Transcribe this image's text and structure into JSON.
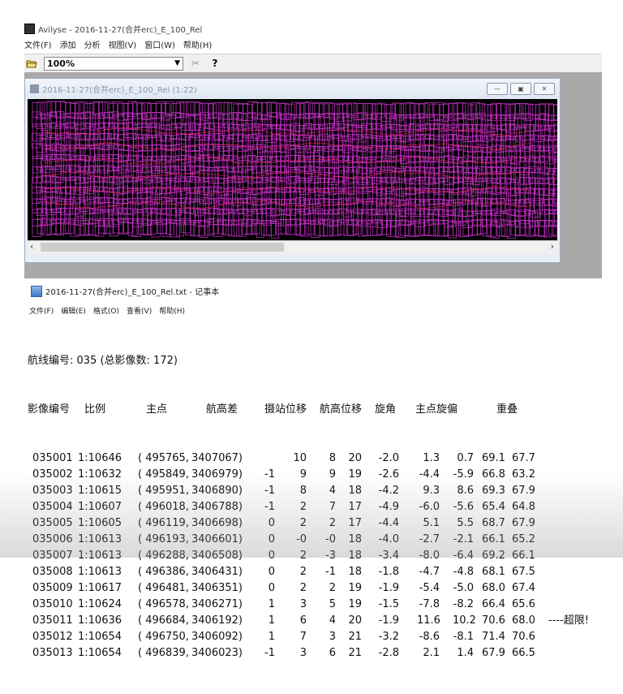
{
  "app": {
    "title": "Avilyse - 2016-11-27(合并erc)_E_100_Rel"
  },
  "menubar": [
    "文件(F)",
    "添加",
    "分析",
    "视图(V)",
    "窗口(W)",
    "帮助(H)"
  ],
  "toolbar": {
    "zoom_value": "100%",
    "cut_icon": "scissors-icon",
    "help_icon": "help-pointer-icon"
  },
  "child_window": {
    "title": "2016-11-27(合并erc)_E_100_Rel (1:22)",
    "buttons": [
      "minimize",
      "restore",
      "close"
    ],
    "canvas_colors": {
      "background": "#000000",
      "footprints": "#cc33cc",
      "highlight": "#ff2255"
    }
  },
  "notepad": {
    "title": "2016-11-27(合并erc)_E_100_Rel.txt - 记事本",
    "menu": [
      "文件(F)",
      "编辑(E)",
      "格式(O)",
      "查看(V)",
      "帮助(H)"
    ],
    "line_info": "航线编号: 035 (总影像数: 172)",
    "headers": [
      "影像编号",
      "比例",
      "主点",
      "航高差",
      "摄站位移",
      "航高位移",
      "旋角",
      "主点旋偏",
      "重叠"
    ],
    "rows": [
      [
        "035001",
        "1:10646",
        "(  495765,",
        "3407067)",
        "",
        "10",
        "8",
        "20",
        "-2.0",
        "1.3",
        "0.7",
        "69.1",
        "67.7",
        ""
      ],
      [
        "035002",
        "1:10632",
        "(  495849,",
        "3406979)",
        "-1",
        "9",
        "9",
        "19",
        "-2.6",
        "-4.4",
        "-5.9",
        "66.8",
        "63.2",
        ""
      ],
      [
        "035003",
        "1:10615",
        "(  495951,",
        "3406890)",
        "-1",
        "8",
        "4",
        "18",
        "-4.2",
        "9.3",
        "8.6",
        "69.3",
        "67.9",
        ""
      ],
      [
        "035004",
        "1:10607",
        "(  496018,",
        "3406788)",
        "-1",
        "2",
        "7",
        "17",
        "-4.9",
        "-6.0",
        "-5.6",
        "65.4",
        "64.8",
        ""
      ],
      [
        "035005",
        "1:10605",
        "(  496119,",
        "3406698)",
        "0",
        "2",
        "2",
        "17",
        "-4.4",
        "5.1",
        "5.5",
        "68.7",
        "67.9",
        ""
      ],
      [
        "035006",
        "1:10613",
        "(  496193,",
        "3406601)",
        "0",
        "-0",
        "-0",
        "18",
        "-4.0",
        "-2.7",
        "-2.1",
        "66.1",
        "65.2",
        ""
      ],
      [
        "035007",
        "1:10613",
        "(  496288,",
        "3406508)",
        "0",
        "2",
        "-3",
        "18",
        "-3.4",
        "-8.0",
        "-6.4",
        "69.2",
        "66.1",
        ""
      ],
      [
        "035008",
        "1:10613",
        "(  496386,",
        "3406431)",
        "0",
        "2",
        "-1",
        "18",
        "-1.8",
        "-4.7",
        "-4.8",
        "68.1",
        "67.5",
        ""
      ],
      [
        "035009",
        "1:10617",
        "(  496481,",
        "3406351)",
        "0",
        "2",
        "2",
        "19",
        "-1.9",
        "-5.4",
        "-5.0",
        "68.0",
        "67.4",
        ""
      ],
      [
        "035010",
        "1:10624",
        "(  496578,",
        "3406271)",
        "1",
        "3",
        "5",
        "19",
        "-1.5",
        "-7.8",
        "-8.2",
        "66.4",
        "65.6",
        ""
      ],
      [
        "035011",
        "1:10636",
        "(  496684,",
        "3406192)",
        "1",
        "6",
        "4",
        "20",
        "-1.9",
        "11.6",
        "10.2",
        "70.6",
        "68.0",
        "----超限!"
      ],
      [
        "035012",
        "1:10654",
        "(  496750,",
        "3406092)",
        "1",
        "7",
        "3",
        "21",
        "-3.2",
        "-8.6",
        "-8.1",
        "71.4",
        "70.6",
        ""
      ],
      [
        "035013",
        "1:10654",
        "(  496839,",
        "3406023)",
        "-1",
        "3",
        "6",
        "21",
        "-2.8",
        "2.1",
        "1.4",
        "67.9",
        "66.5",
        ""
      ]
    ]
  }
}
